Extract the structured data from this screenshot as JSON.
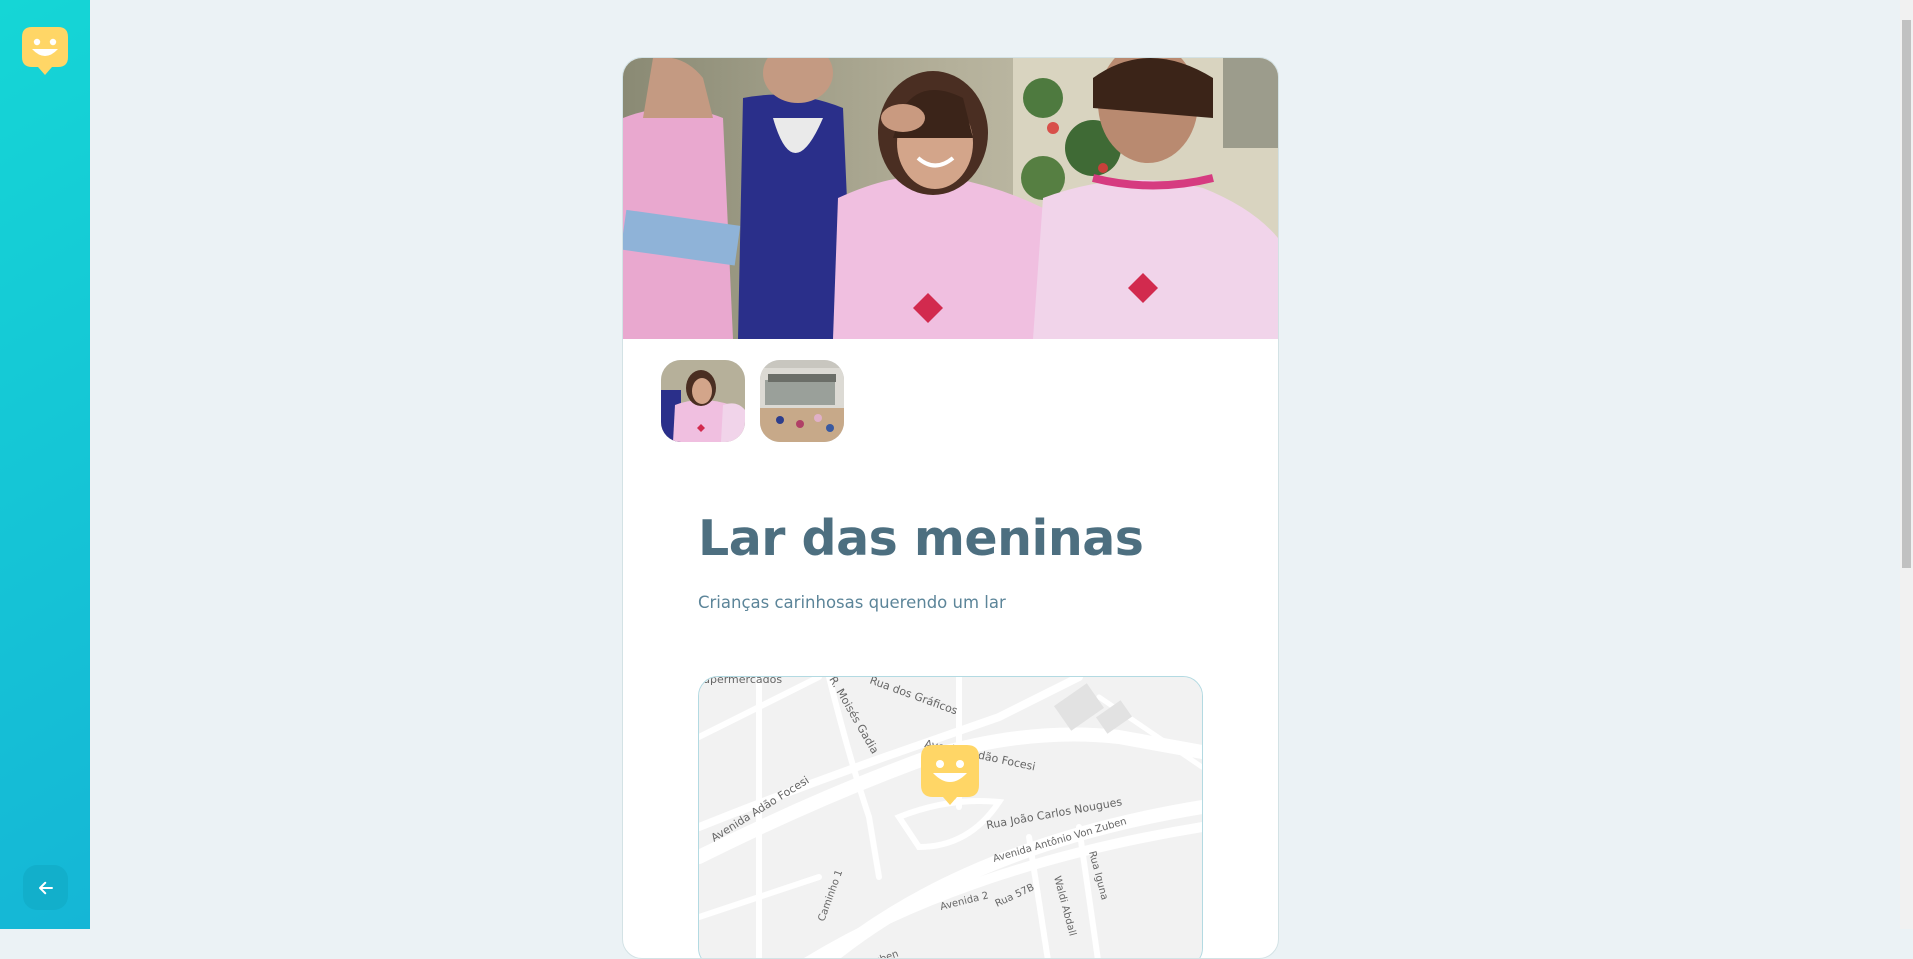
{
  "sidebar": {
    "logo_icon": "smiley-marker-icon",
    "back_icon": "arrow-left-icon"
  },
  "orphanage": {
    "name": "Lar das meninas",
    "about": "Crianças carinhosas querendo um lar"
  },
  "gallery": {
    "thumbnails": [
      "thumbnail-girls",
      "thumbnail-playground"
    ]
  },
  "map": {
    "marker_icon": "smiley-marker-icon",
    "labels": {
      "supermarkets": "upermercados",
      "rua_moises": "R. Moisés Gadia",
      "rua_graficos": "Rua dos Gráficos",
      "av_adao_top": "Avenida Adão Focesi",
      "av_adao_left": "Avenida Adão Focesi",
      "rua_joao": "Rua João Carlos Nougues",
      "av_antonio": "Avenida Antônio Von Zuben",
      "rua_iguna": "Rua Iguna",
      "waldi": "Waldi Abdall",
      "av_2": "Avenida 2",
      "rua_57b": "Rua 57B",
      "caminho": "Caminho 1",
      "zuben": "Zuben"
    }
  },
  "colors": {
    "sidebar_from": "#15d6d6",
    "sidebar_to": "#15b6d6",
    "logo_yellow": "#ffd666",
    "title": "#4d6f80",
    "subtitle": "#5c8599",
    "background": "#ebf2f5"
  }
}
